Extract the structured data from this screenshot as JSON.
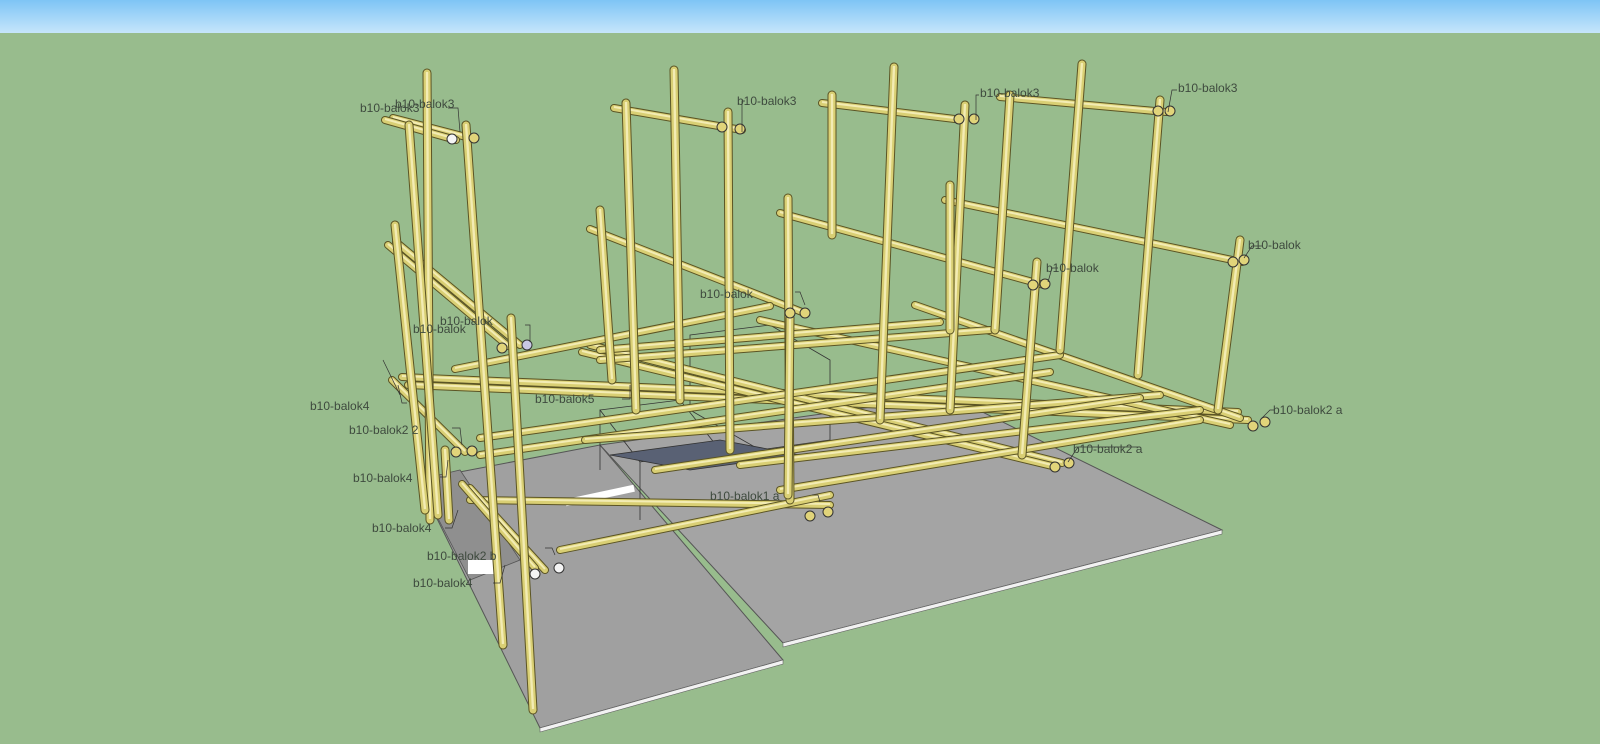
{
  "viewport": {
    "sky_color": "#a9d8f8",
    "ground_color": "#98bc8d",
    "slab_color": "#a0a0a0",
    "timber_color": "#dcd27a"
  },
  "labels": [
    {
      "id": "l1",
      "text": "b10-balok3"
    },
    {
      "id": "l2",
      "text": "b10-balok3"
    },
    {
      "id": "l3",
      "text": "b10-balok3"
    },
    {
      "id": "l4",
      "text": "b10-balok3"
    },
    {
      "id": "l5",
      "text": "b10-balok3"
    },
    {
      "id": "l6",
      "text": "b10-balok"
    },
    {
      "id": "l7",
      "text": "b10-balok"
    },
    {
      "id": "l8",
      "text": "b10-balok"
    },
    {
      "id": "l9",
      "text": "b10-balok"
    },
    {
      "id": "l10",
      "text": "b10-balok"
    },
    {
      "id": "l11",
      "text": "b10-balok5"
    },
    {
      "id": "l12",
      "text": "b10-balok4"
    },
    {
      "id": "l13",
      "text": "b10-balok4"
    },
    {
      "id": "l14",
      "text": "b10-balok4"
    },
    {
      "id": "l15",
      "text": "b10-balok4"
    },
    {
      "id": "l16",
      "text": "b10-balok2 2"
    },
    {
      "id": "l17",
      "text": "b10-balok2 b"
    },
    {
      "id": "l18",
      "text": "b10-balok1 a"
    },
    {
      "id": "l19",
      "text": "b10-balok2 a"
    },
    {
      "id": "l20",
      "text": "b10-balok2 a"
    }
  ]
}
